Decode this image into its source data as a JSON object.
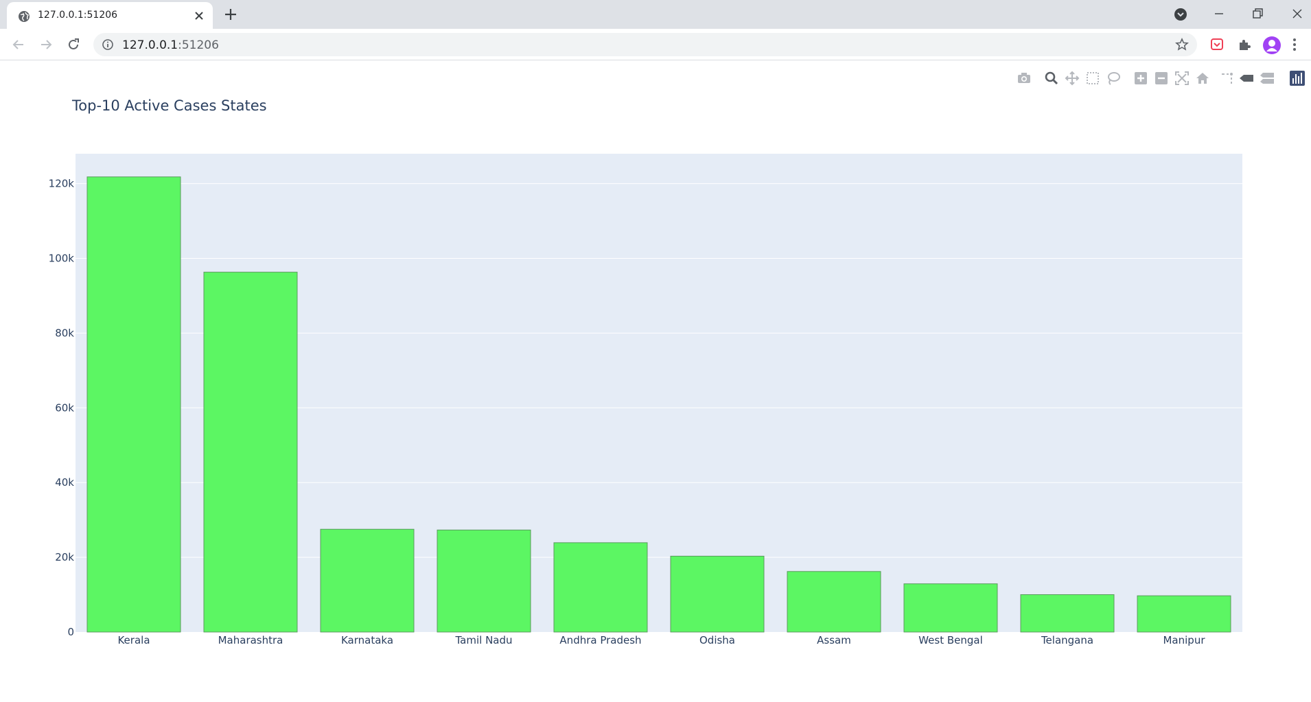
{
  "browser": {
    "tab_title": "127.0.0.1:51206",
    "url_host": "127.0.0.1",
    "url_port": ":51206",
    "icons": [
      "globe-icon",
      "close-icon",
      "plus-icon",
      "back-icon",
      "forward-icon",
      "reload-icon",
      "info-icon",
      "star-icon",
      "pocket-icon",
      "puzzle-icon",
      "menu-icon"
    ]
  },
  "modebar": {
    "buttons": [
      "camera-icon",
      "zoom-icon",
      "pan-icon",
      "box-select-icon",
      "lasso-icon",
      "zoom-in-icon",
      "zoom-out-icon",
      "autoscale-icon",
      "reset-axes-icon",
      "spike-lines-icon",
      "hover-closest-icon",
      "hover-compare-icon",
      "plotly-logo-icon"
    ]
  },
  "chart_data": {
    "type": "bar",
    "title": "Top-10 Active Cases States",
    "xlabel": "",
    "ylabel": "",
    "categories": [
      "Kerala",
      "Maharashtra",
      "Karnataka",
      "Tamil Nadu",
      "Andhra Pradesh",
      "Odisha",
      "Assam",
      "West Bengal",
      "Telangana",
      "Manipur"
    ],
    "values": [
      121800,
      96300,
      27500,
      27300,
      23900,
      20300,
      16200,
      12900,
      10000,
      9700
    ],
    "ylim": [
      0,
      128000
    ],
    "yticks": [
      0,
      20000,
      40000,
      60000,
      80000,
      100000,
      120000
    ],
    "ytick_labels": [
      "0",
      "20k",
      "40k",
      "60k",
      "80k",
      "100k",
      "120k"
    ],
    "grid": true,
    "bar_color": "#5cf663",
    "bar_line_color": "#5a9a5e",
    "plot_bg": "#e5ecf6",
    "legend": "none"
  }
}
